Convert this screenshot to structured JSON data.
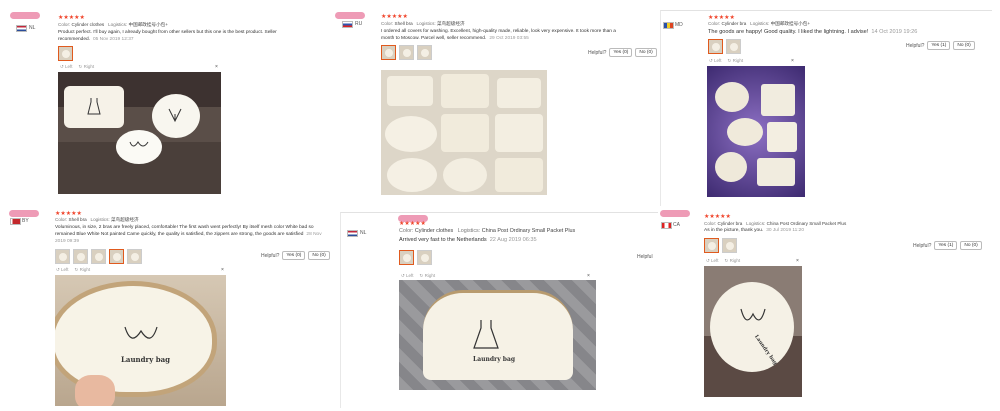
{
  "reviews": [
    {
      "country": "NL",
      "stars": "★★★★★",
      "color_label": "Color:",
      "color_value": "Cylinder clothes",
      "logistics_label": "Logistics:",
      "logistics_value": "中国邮政挂号小包+",
      "text": "Product perfect. I'll buy again, I already bought from other sellers but this one is the best product. Seller recommended.",
      "date": "05 Nov 2019 12:37",
      "rotate_left": "Left",
      "rotate_right": "Right",
      "close": "×"
    },
    {
      "country": "RU",
      "stars": "★★★★★",
      "color_label": "Color:",
      "color_value": "Shell bra",
      "logistics_label": "Logistics:",
      "logistics_value": "菜鸟超级经济",
      "text": "I ordered all covers for washing. Excellent, high-quality made, reliable, look very expensive. It took more than a month to Moscow. Parcel well, seller recommend.",
      "date": "29 Oct 2019 03:55",
      "helpful": "Helpful?",
      "yes": "Yes (0)",
      "no": "No (0)"
    },
    {
      "country": "MD",
      "stars": "★★★★★",
      "color_label": "Color:",
      "color_value": "Cylinder bra",
      "logistics_label": "Logistics:",
      "logistics_value": "中国邮政挂号小包+",
      "text": "The goods are happy! Good quality. I liked the lightning. I advise!",
      "date": "14 Oct 2019 19:26",
      "helpful": "Helpful?",
      "yes": "Yes (1)",
      "no": "No (0)",
      "rotate_left": "Left",
      "rotate_right": "Right",
      "close": "×"
    },
    {
      "country": "BY",
      "stars": "★★★★★",
      "color_label": "Color:",
      "color_value": "Shell bra",
      "logistics_label": "Logistics:",
      "logistics_value": "菜鸟超级经济",
      "text": "Voluminous, in size, 2 bras are freely placed, comfortable! The first wash went perfectly! By itself mesh color White bad so remained Blue White Not painted Came quickly, the quality is satisfied, the zippers are strong, the goods are satisfied",
      "date": "28 Nov 2019 09:39",
      "helpful": "Helpful?",
      "yes": "Yes (0)",
      "no": "No (0)",
      "rotate_left": "Left",
      "rotate_right": "Right",
      "close": "×",
      "bag_text": "Laundry bag"
    },
    {
      "country": "NL",
      "stars": "★★★★★",
      "color_label": "Color:",
      "color_value": "Cylinder clothes",
      "logistics_label": "Logistics:",
      "logistics_value": "China Post Ordinary Small Packet Plus",
      "text": "Arrived very fast to the Netherlands",
      "date": "22 Aug 2019 06:35",
      "helpful": "Helpful",
      "rotate_left": "Left",
      "rotate_right": "Right",
      "close": "×",
      "bag_text": "Laundry bag"
    },
    {
      "country": "CA",
      "stars": "★★★★★",
      "color_label": "Color:",
      "color_value": "Cylinder bra",
      "logistics_label": "Logistics:",
      "logistics_value": "China Post Ordinary Small Packet Plus",
      "text": "As in the picture, thank you.",
      "date": "30 Jul 2019 11:20",
      "helpful": "Helpful?",
      "yes": "Yes (1)",
      "no": "No (0)",
      "rotate_left": "Left",
      "rotate_right": "Right",
      "close": "×",
      "bag_text": "Laundry bag"
    }
  ],
  "colors": {
    "star": "#f0442b",
    "redaction": "#ee9bb6",
    "accent": "#e05a1e"
  }
}
